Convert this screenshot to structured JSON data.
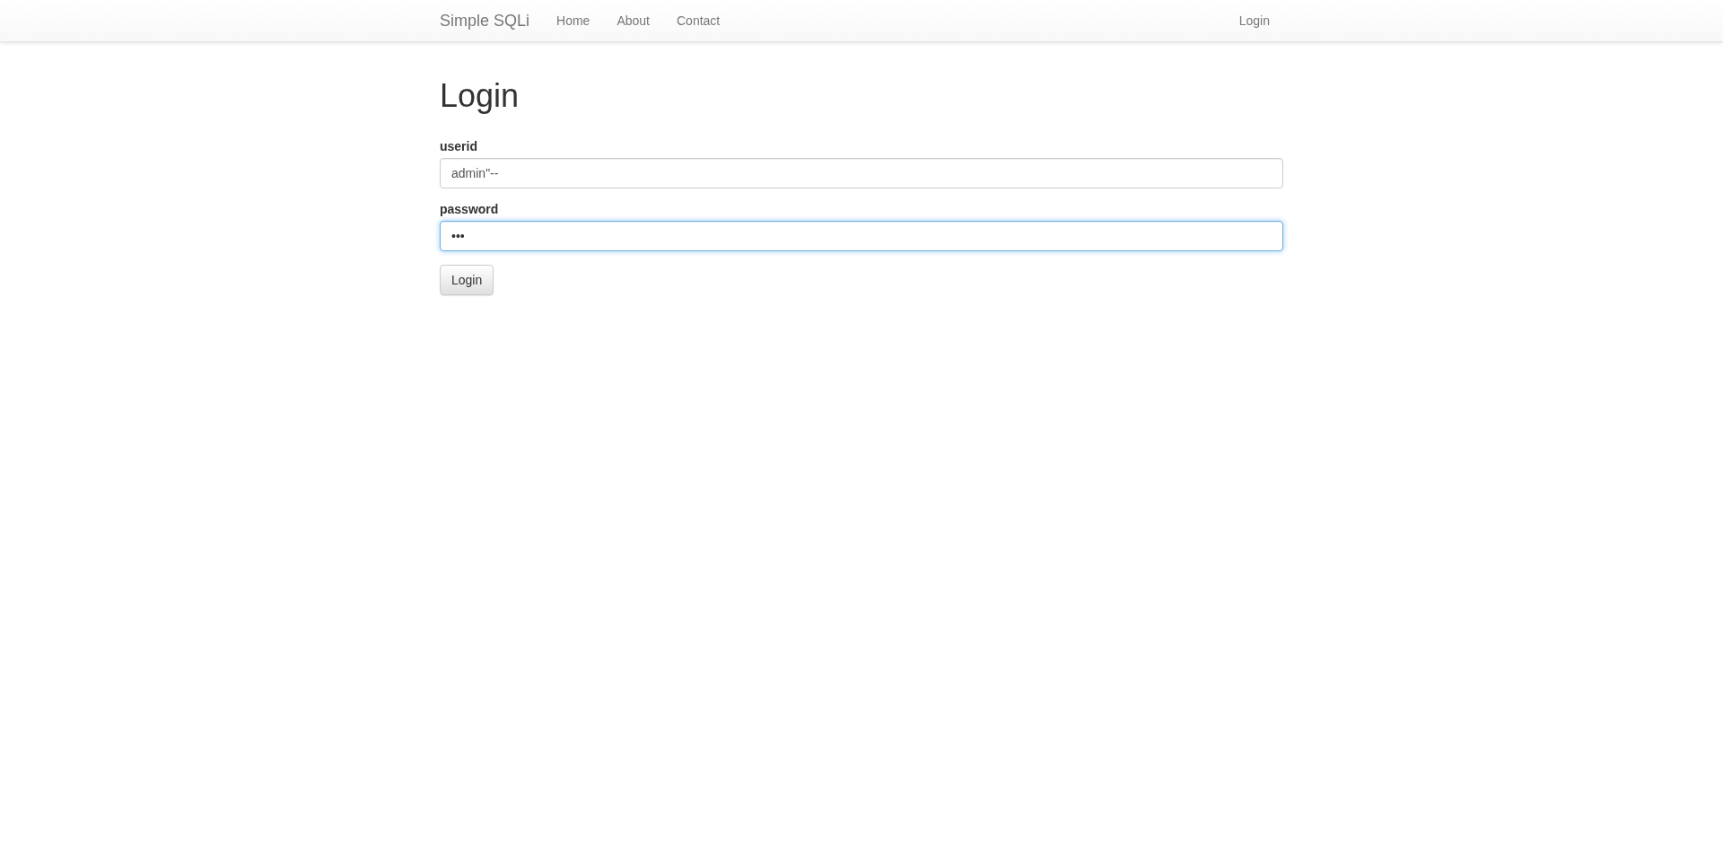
{
  "navbar": {
    "brand": "Simple SQLi",
    "links": [
      {
        "label": "Home"
      },
      {
        "label": "About"
      },
      {
        "label": "Contact"
      }
    ],
    "right_links": [
      {
        "label": "Login"
      }
    ]
  },
  "heading": "Login",
  "fields": [
    {
      "label": "userid",
      "value": "admin\"--",
      "focused": false
    },
    {
      "label": "password",
      "value": "•••",
      "focused": true
    }
  ],
  "submit_button": "Login"
}
